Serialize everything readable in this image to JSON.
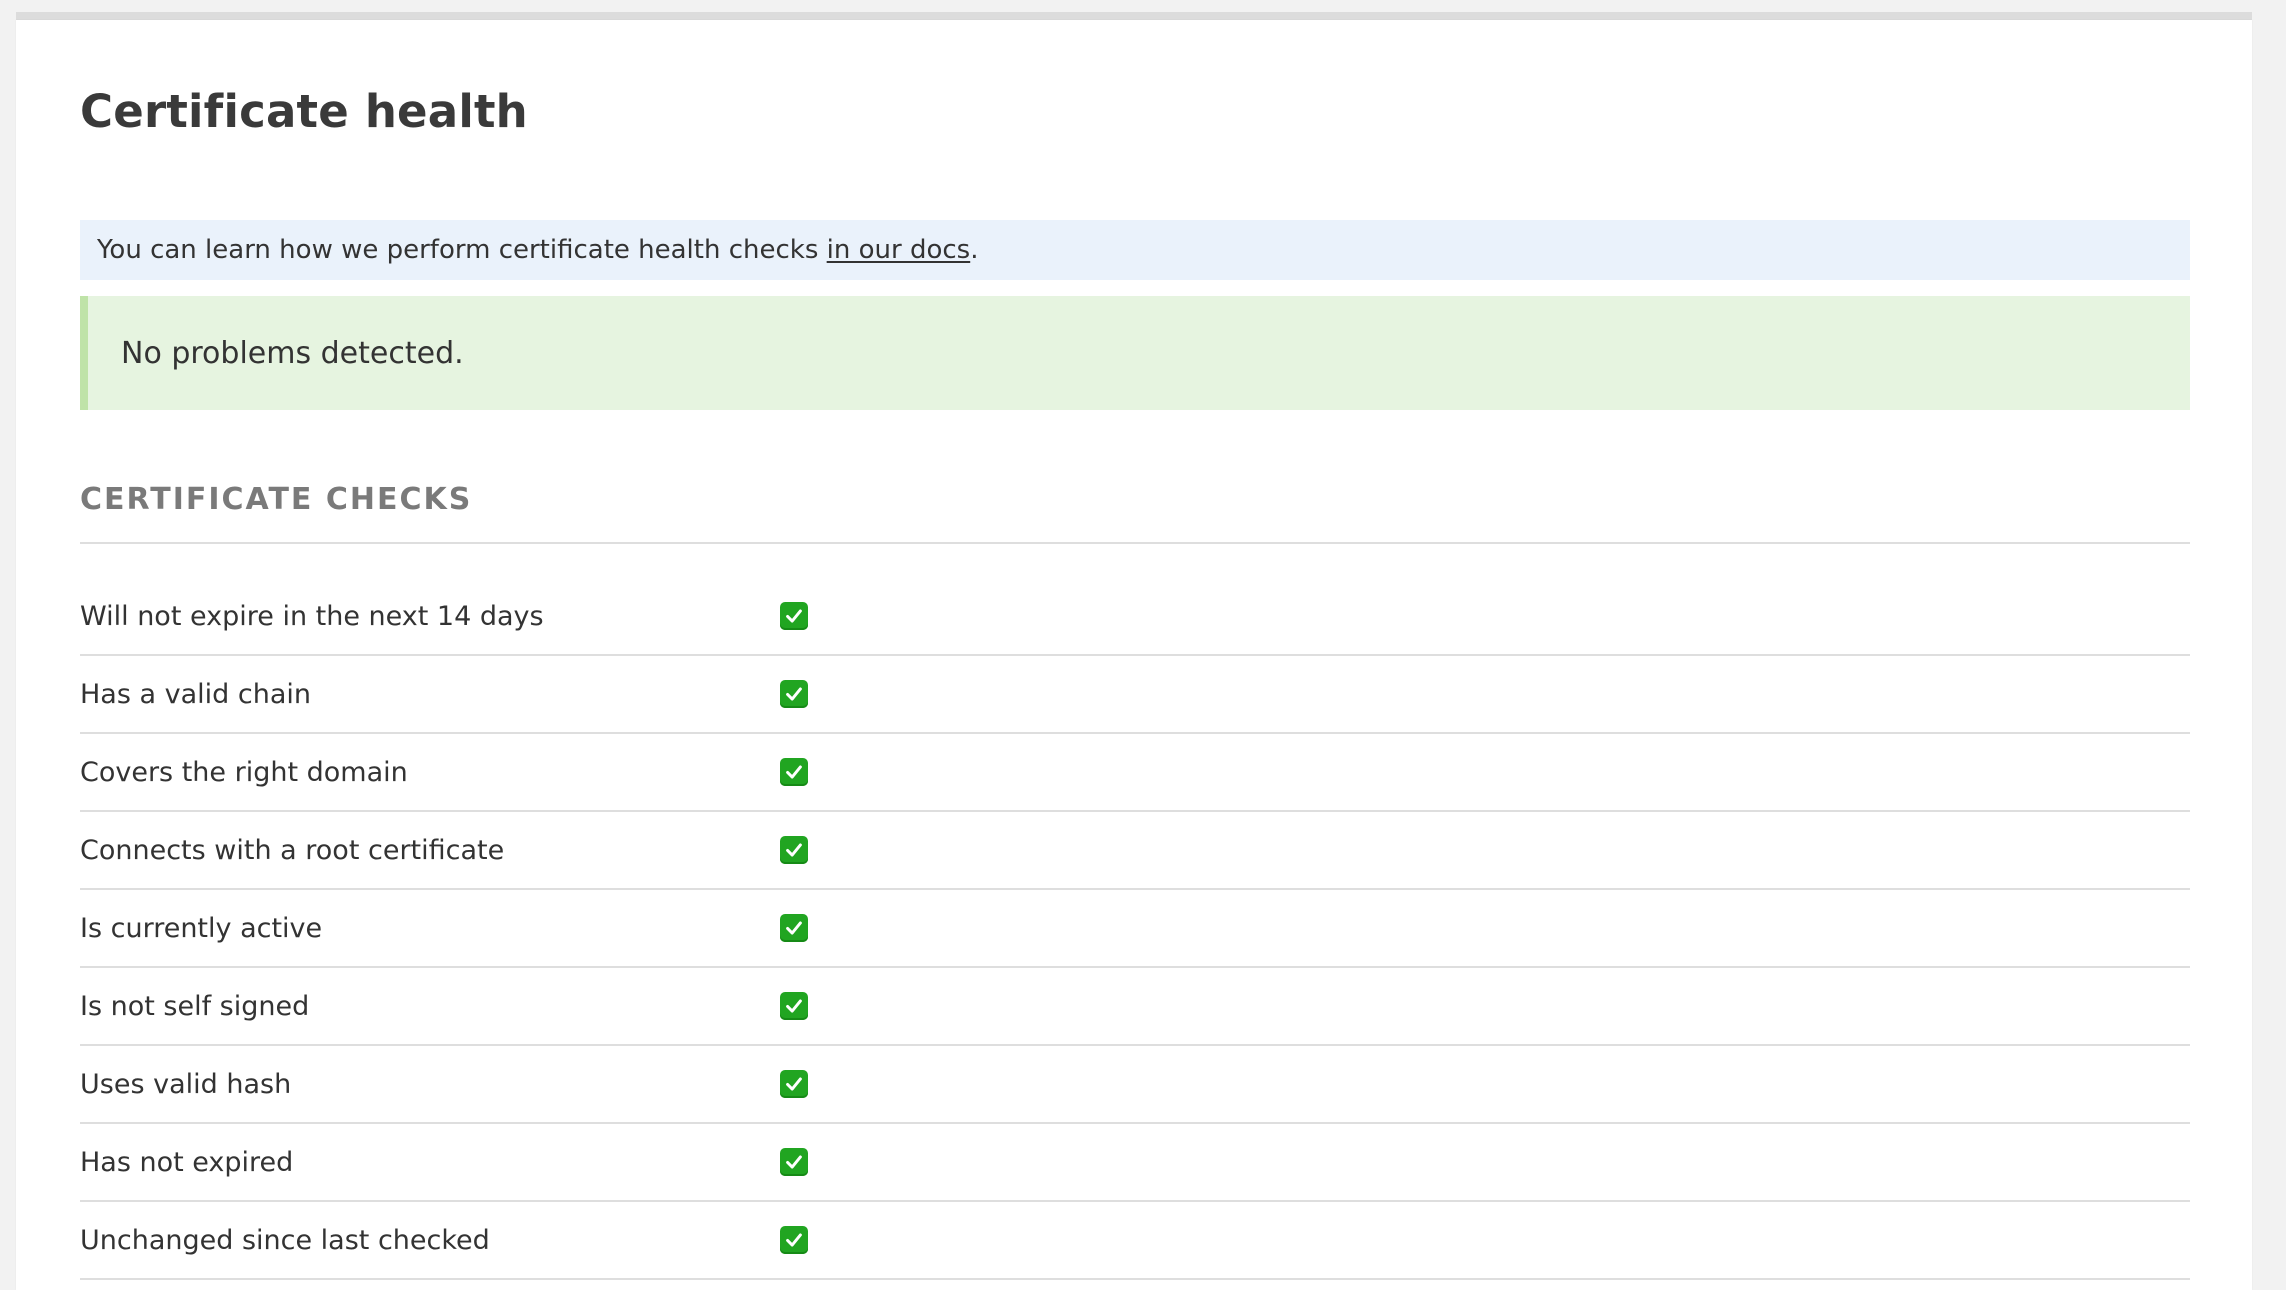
{
  "page": {
    "title": "Certificate health"
  },
  "info_banner": {
    "text_before": "You can learn how we perform certificate health checks ",
    "link_text": "in our docs",
    "text_after": "."
  },
  "status_banner": {
    "text": "No problems detected.",
    "accent_color": "#bfe3a8",
    "background_color": "#e6f4e0"
  },
  "checks_section": {
    "heading": "CERTIFICATE CHECKS",
    "status_icon": "check-mark-button",
    "items": [
      {
        "label": "Will not expire in the next 14 days",
        "passed": true
      },
      {
        "label": "Has a valid chain",
        "passed": true
      },
      {
        "label": "Covers the right domain",
        "passed": true
      },
      {
        "label": "Connects with a root certificate",
        "passed": true
      },
      {
        "label": "Is currently active",
        "passed": true
      },
      {
        "label": "Is not self signed",
        "passed": true
      },
      {
        "label": "Uses valid hash",
        "passed": true
      },
      {
        "label": "Has not expired",
        "passed": true
      },
      {
        "label": "Unchanged since last checked",
        "passed": true
      }
    ]
  }
}
